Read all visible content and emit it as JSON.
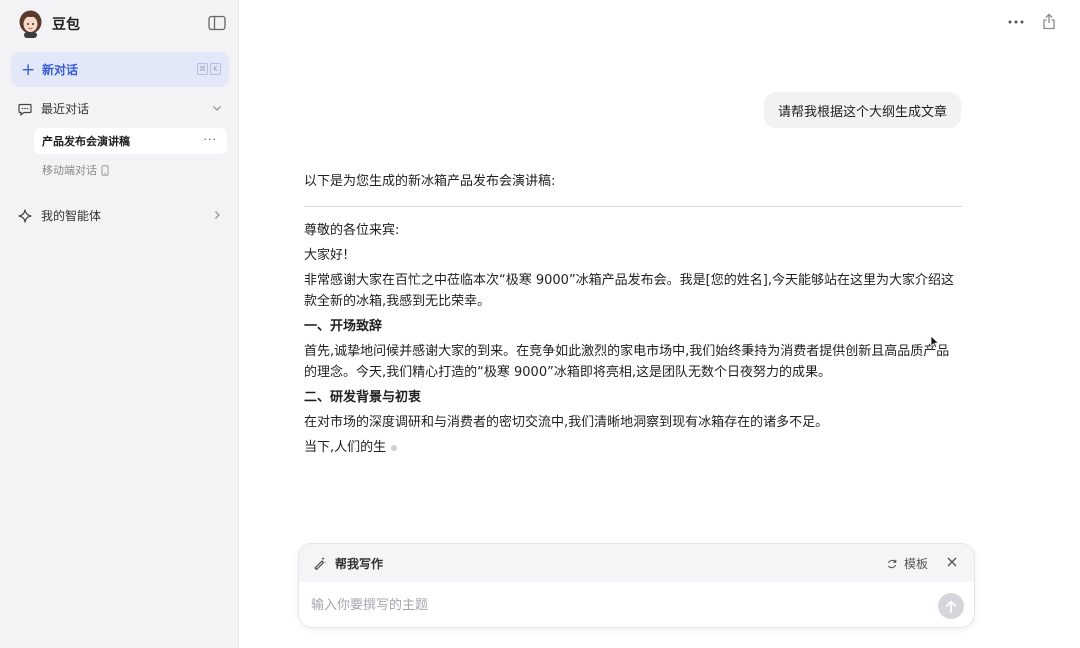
{
  "app": {
    "name": "豆包"
  },
  "sidebar": {
    "new_chat_label": "新对话",
    "new_chat_shortcut": [
      "⌘",
      "K"
    ],
    "recent_label": "最近对话",
    "conversations": [
      {
        "label": "产品发布会演讲稿",
        "active": true
      },
      {
        "label": "移动端对话",
        "active": false
      }
    ],
    "agents_label": "我的智能体"
  },
  "chat": {
    "user_message": "请帮我根据这个大纲生成文章",
    "assistant": {
      "intro": "以下是为您生成的新冰箱产品发布会演讲稿:",
      "greeting": "尊敬的各位来宾:",
      "hello": "大家好!",
      "para1": "非常感谢大家在百忙之中莅临本次“极寒 9000”冰箱产品发布会。我是[您的姓名],今天能够站在这里为大家介绍这款全新的冰箱,我感到无比荣幸。",
      "heading1": "一、开场致辞",
      "para2": "首先,诚挚地问候并感谢大家的到来。在竞争如此激烈的家电市场中,我们始终秉持为消费者提供创新且高品质产品的理念。今天,我们精心打造的“极寒 9000”冰箱即将亮相,这是团队无数个日夜努力的成果。",
      "heading2": "二、研发背景与初衷",
      "para3": "在对市场的深度调研和与消费者的密切交流中,我们清晰地洞察到现有冰箱存在的诸多不足。",
      "para4": "当下,人们的生"
    }
  },
  "composer": {
    "mode_label": "帮我写作",
    "template_label": "模板",
    "placeholder": "输入你要撰写的主题"
  },
  "colors": {
    "accent": "#3a5bd9",
    "sidebar_bg": "#f3f3f5",
    "new_chat_bg": "#e3e8f8"
  }
}
